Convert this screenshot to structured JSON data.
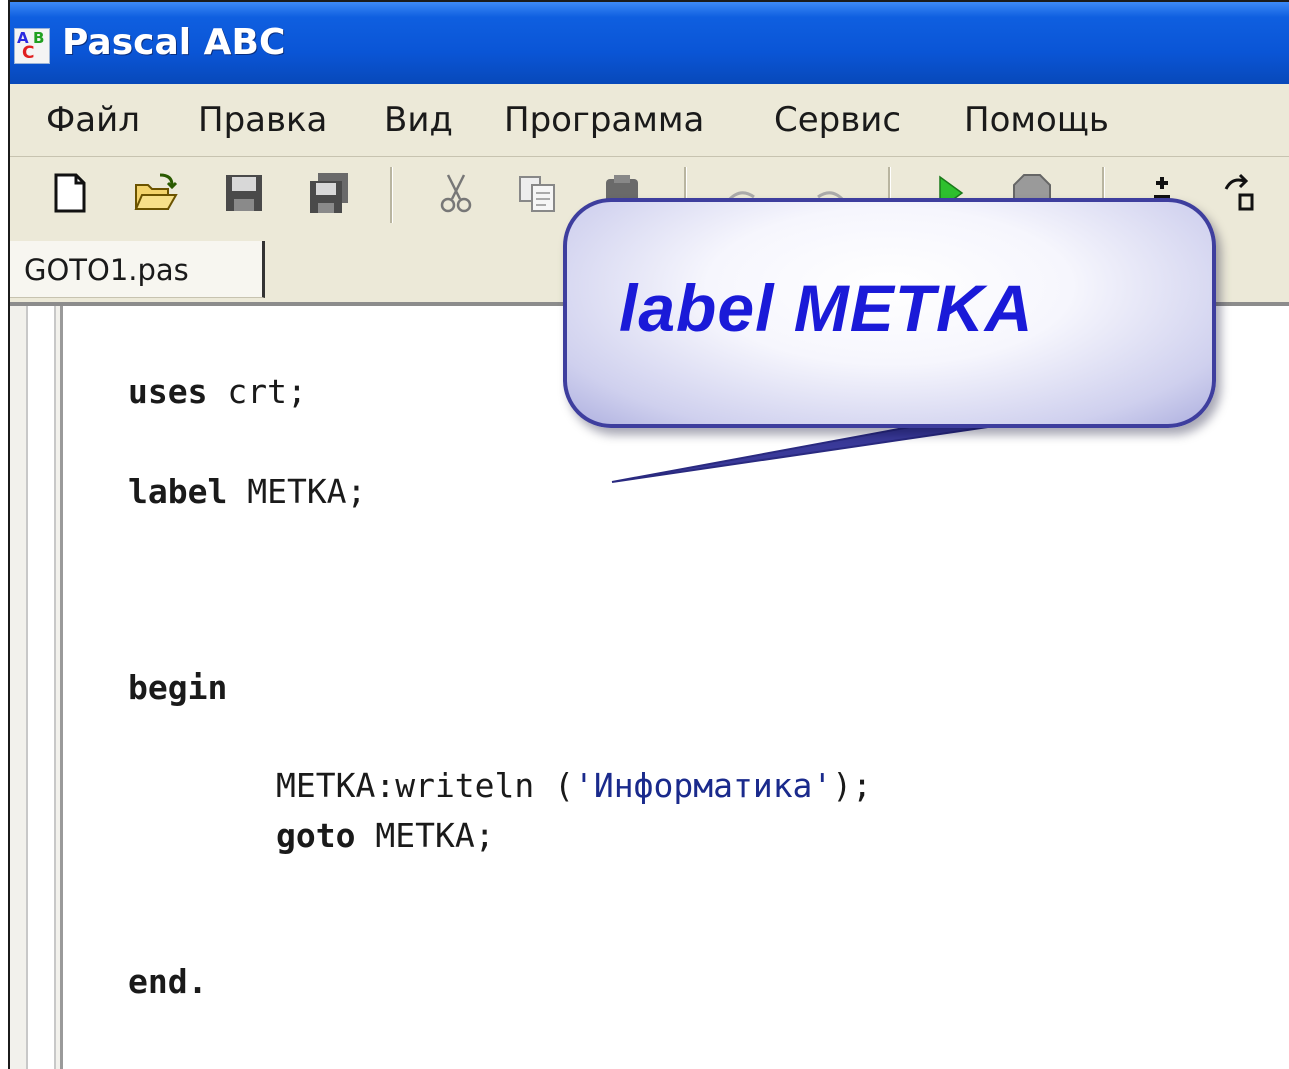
{
  "window": {
    "title": "Pascal ABC",
    "icon": "pascal-abc-app-icon",
    "icon_letters": {
      "a": "A",
      "b": "B",
      "c": "C"
    }
  },
  "menu": {
    "items": [
      {
        "label": "Файл"
      },
      {
        "label": "Правка"
      },
      {
        "label": "Вид"
      },
      {
        "label": "Программа"
      },
      {
        "label": "Сервис"
      },
      {
        "label": "Помощь"
      }
    ]
  },
  "toolbar": {
    "buttons": [
      {
        "icon": "new-file-icon"
      },
      {
        "icon": "open-folder-icon"
      },
      {
        "icon": "save-icon"
      },
      {
        "icon": "save-all-icon"
      },
      {
        "icon": "cut-icon"
      },
      {
        "icon": "copy-icon"
      },
      {
        "icon": "paste-icon"
      },
      {
        "icon": "undo-icon"
      },
      {
        "icon": "redo-icon"
      },
      {
        "icon": "run-icon"
      },
      {
        "icon": "stop-icon"
      },
      {
        "icon": "step-into-icon"
      },
      {
        "icon": "step-over-icon"
      }
    ]
  },
  "tabs": [
    {
      "label": "GOTO1.pas",
      "active": true
    }
  ],
  "editor": {
    "lines": {
      "l1_kw": "uses",
      "l1_rest": " crt;",
      "l2_kw": "label",
      "l2_rest": " METKA;",
      "l3_kw": "begin",
      "l4_pre": "METKA:writeln (",
      "l4_str": "'Информатика'",
      "l4_post": ");",
      "l5_kw": "goto",
      "l5_rest": " METKA;",
      "l6_kw": "end."
    }
  },
  "callout": {
    "text": "label METKA"
  },
  "colors": {
    "titlebar": "#0a55d6",
    "callout_text": "#1a1ad8",
    "string_literal": "#1a2a8c"
  }
}
